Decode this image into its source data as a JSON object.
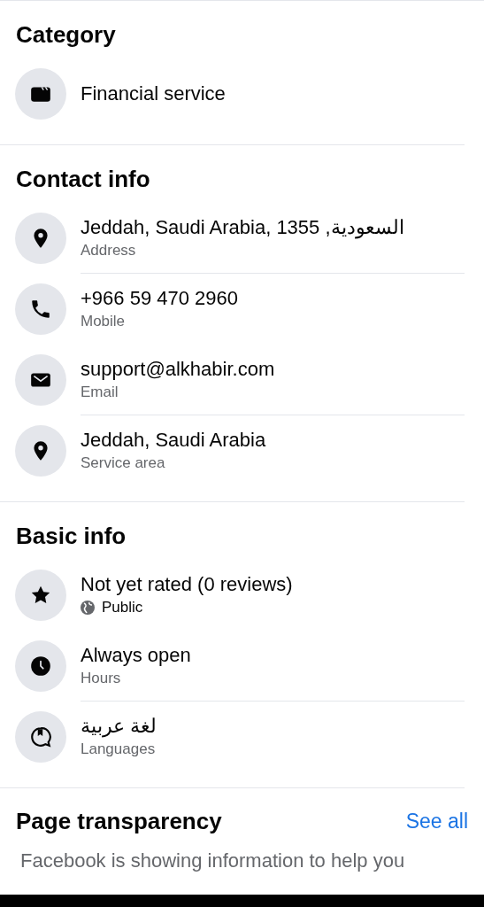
{
  "sections": [
    {
      "title": "Category",
      "items": [
        {
          "primary": "Financial service",
          "divider_below": false
        }
      ]
    },
    {
      "title": "Contact info",
      "items": [
        {
          "primary": "Jeddah, Saudi Arabia, 1355 ,السعودية",
          "secondary": "Address",
          "divider_below": true
        },
        {
          "primary": "+966 59 470 2960",
          "secondary": "Mobile",
          "divider_below": false
        },
        {
          "primary": "support@alkhabir.com",
          "secondary": "Email",
          "divider_below": true
        },
        {
          "primary": "Jeddah, Saudi Arabia",
          "secondary": "Service area",
          "divider_below": false
        }
      ]
    },
    {
      "title": "Basic info",
      "items": [
        {
          "primary": "Not yet rated (0 reviews)",
          "secondary": "Public",
          "audience": true,
          "divider_below": false
        },
        {
          "primary": "Always open",
          "secondary": "Hours",
          "divider_below": true
        },
        {
          "primary": "لغة عربية",
          "secondary": "Languages",
          "divider_below": false
        }
      ]
    }
  ],
  "transparency": {
    "title": "Page transparency",
    "link": "See all",
    "body": "Facebook is showing information to help you"
  }
}
